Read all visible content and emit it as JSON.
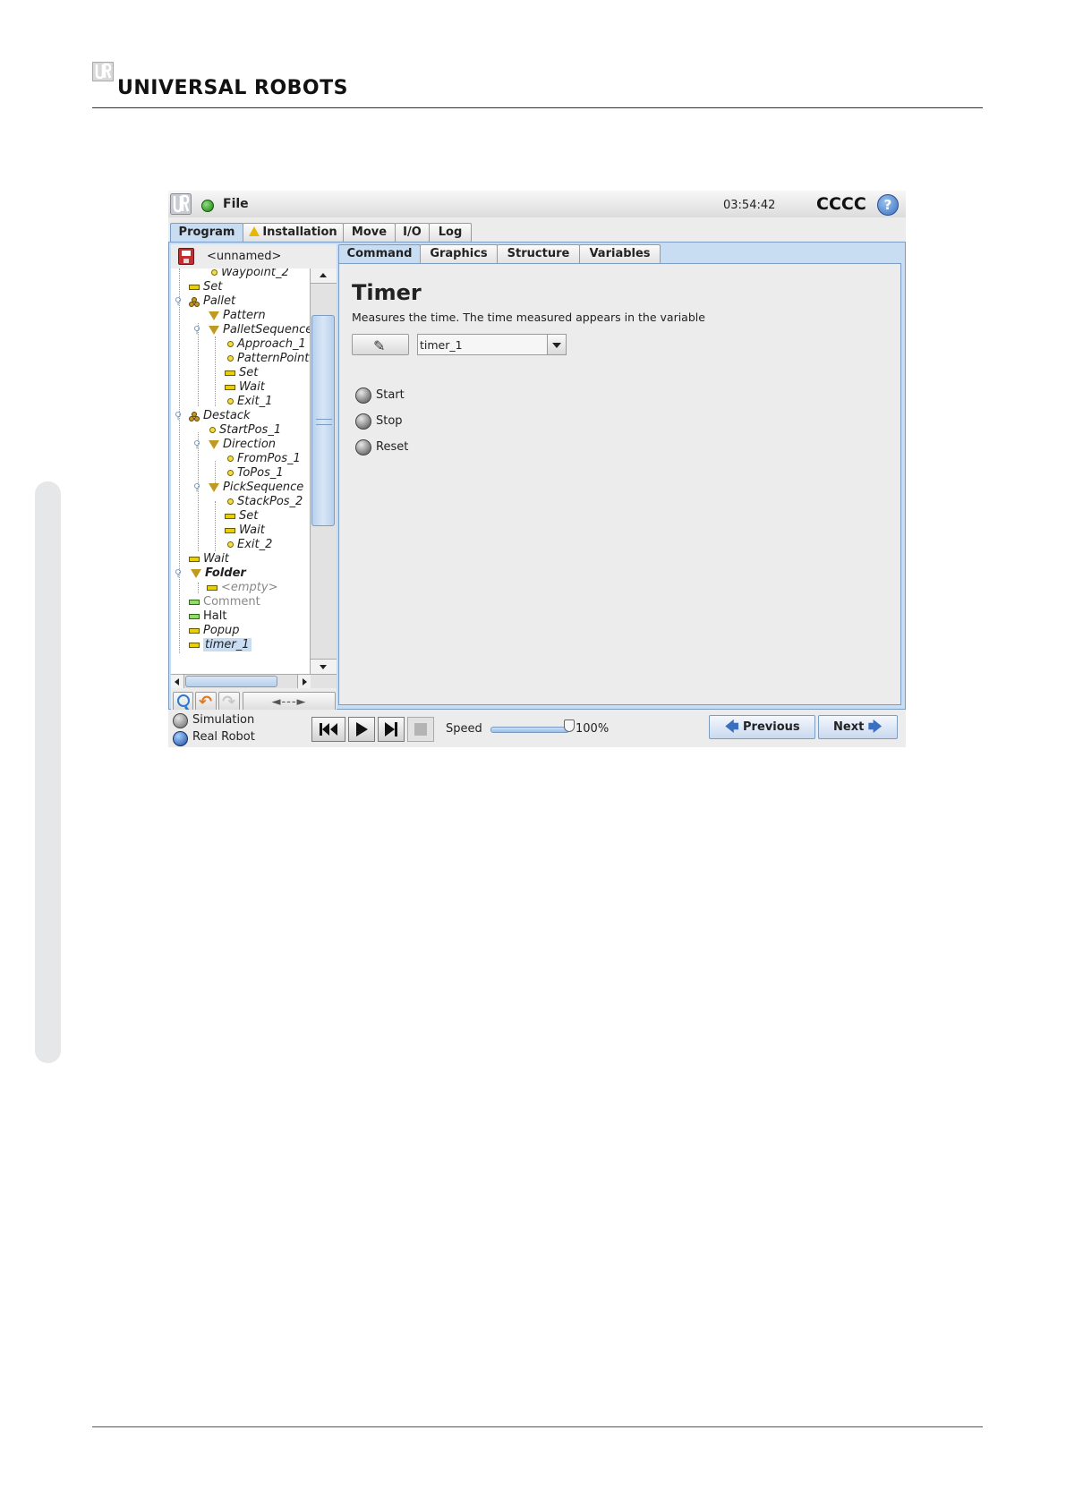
{
  "doc": {
    "brand": "UNIVERSAL ROBOTS"
  },
  "titlebar": {
    "file_menu": "File",
    "clock": "03:54:42",
    "robot_name": "CCCC",
    "help_label": "?"
  },
  "main_tabs": [
    {
      "label": "Program",
      "active": true
    },
    {
      "label": "Installation",
      "warning": true
    },
    {
      "label": "Move"
    },
    {
      "label": "I/O"
    },
    {
      "label": "Log"
    }
  ],
  "tree": {
    "program_name": "<unnamed>",
    "nodes": [
      {
        "label": "Waypoint_2",
        "icon": "waypoint-icon"
      },
      {
        "label": "Set",
        "icon": "command-icon"
      },
      {
        "label": "Pallet",
        "icon": "pallet-icon"
      },
      {
        "label": "Pattern",
        "icon": "folder-icon"
      },
      {
        "label": "PalletSequence",
        "icon": "folder-icon"
      },
      {
        "label": "Approach_1",
        "icon": "waypoint-icon"
      },
      {
        "label": "PatternPoint",
        "icon": "waypoint-icon"
      },
      {
        "label": "Set",
        "icon": "command-icon"
      },
      {
        "label": "Wait",
        "icon": "command-icon"
      },
      {
        "label": "Exit_1",
        "icon": "waypoint-icon"
      },
      {
        "label": "Destack",
        "icon": "pallet-icon"
      },
      {
        "label": "StartPos_1",
        "icon": "waypoint-icon"
      },
      {
        "label": "Direction",
        "icon": "folder-icon"
      },
      {
        "label": "FromPos_1",
        "icon": "waypoint-icon"
      },
      {
        "label": "ToPos_1",
        "icon": "waypoint-icon"
      },
      {
        "label": "PickSequence",
        "icon": "folder-icon"
      },
      {
        "label": "StackPos_2",
        "icon": "waypoint-icon"
      },
      {
        "label": "Set",
        "icon": "command-icon"
      },
      {
        "label": "Wait",
        "icon": "command-icon"
      },
      {
        "label": "Exit_2",
        "icon": "waypoint-icon"
      },
      {
        "label": "Wait",
        "icon": "command-icon"
      },
      {
        "label": "Folder",
        "icon": "folder-icon"
      },
      {
        "label": "<empty>",
        "icon": "command-icon"
      },
      {
        "label": "Comment",
        "icon": "command-icon"
      },
      {
        "label": "Halt",
        "icon": "command-icon"
      },
      {
        "label": "Popup",
        "icon": "command-icon"
      },
      {
        "label": "timer_1",
        "icon": "command-icon",
        "selected": true
      }
    ],
    "move_label": "◄---►"
  },
  "sub_tabs": [
    {
      "label": "Command",
      "active": true
    },
    {
      "label": "Graphics"
    },
    {
      "label": "Structure"
    },
    {
      "label": "Variables"
    }
  ],
  "command": {
    "title": "Timer",
    "description": "Measures the time. The time measured appears in the variable",
    "variable": "timer_1",
    "options": [
      {
        "label": "Start"
      },
      {
        "label": "Stop"
      },
      {
        "label": "Reset"
      }
    ]
  },
  "bottom": {
    "simulation_label": "Simulation",
    "real_robot_label": "Real Robot",
    "speed_label": "Speed",
    "speed_value": "100%",
    "speed_fraction": 1.0,
    "previous_label": "Previous",
    "next_label": "Next"
  },
  "colors": {
    "accent_tab": "#c8dcf2",
    "status_ok": "#1e7a14",
    "warning": "#e8b800"
  }
}
